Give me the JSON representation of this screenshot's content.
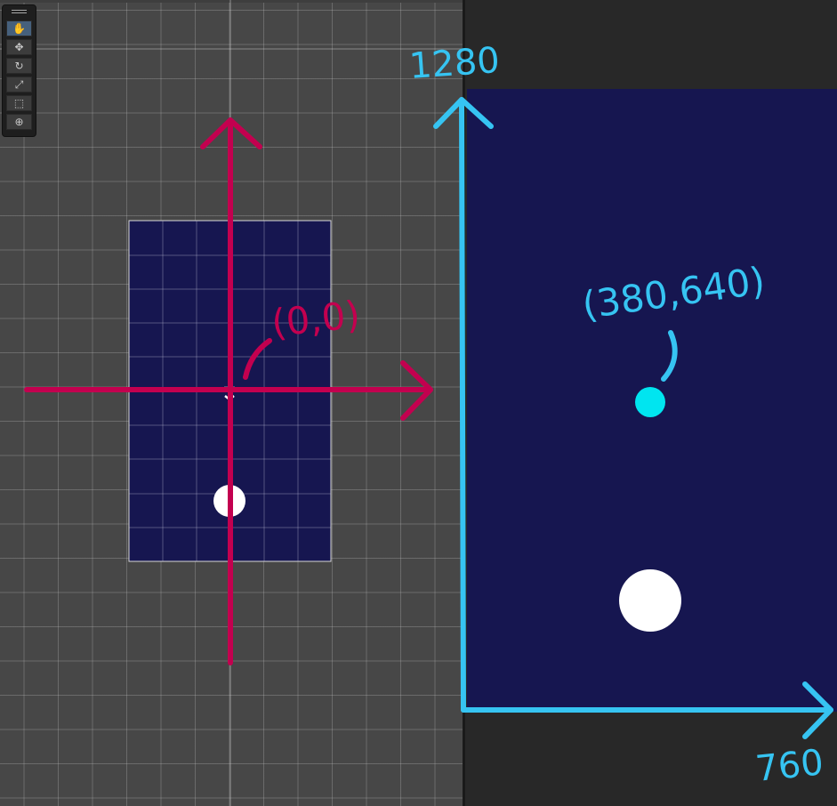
{
  "scene": {
    "origin_label": "(0,0)"
  },
  "toolbar": {
    "tools": [
      {
        "name": "hand-tool-icon",
        "glyph": "✋"
      },
      {
        "name": "move-tool-icon",
        "glyph": "✥"
      },
      {
        "name": "rotate-tool-icon",
        "glyph": "↻"
      },
      {
        "name": "scale-tool-icon",
        "glyph": "⤢"
      },
      {
        "name": "rect-tool-icon",
        "glyph": "⬚"
      },
      {
        "name": "transform-tool-icon",
        "glyph": "⊕"
      }
    ]
  },
  "game": {
    "y_axis_label": "1280",
    "x_axis_label": "760",
    "point_label": "(380,640)"
  },
  "colors": {
    "scene_bg": "#474747",
    "canvas": "#161650",
    "magenta_axis": "#c3004f",
    "cyan_axis": "#36c4f2",
    "cyan_dot": "#00e5f0",
    "white_dot": "#ffffff"
  }
}
